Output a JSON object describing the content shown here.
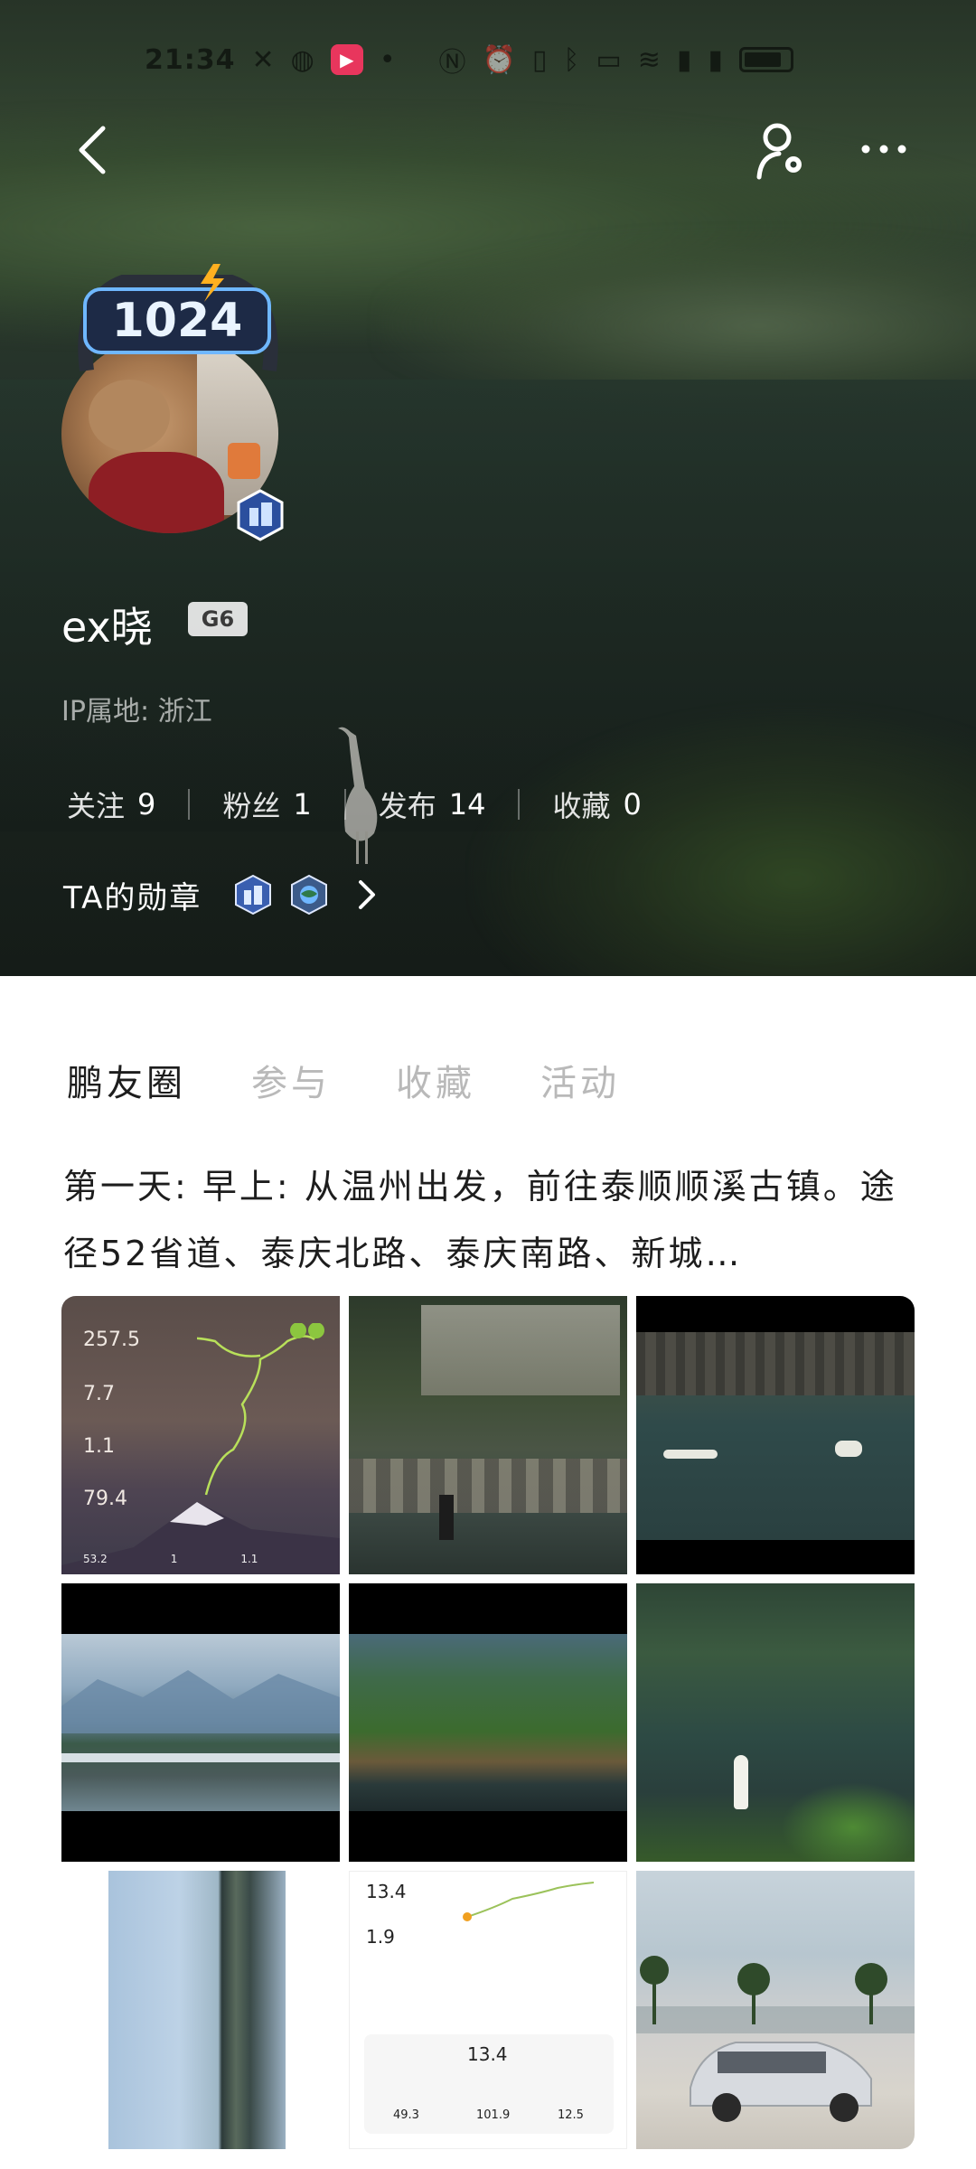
{
  "status_bar": {
    "time": "21:34"
  },
  "profile": {
    "avatar_frame_text": "1024",
    "username": "ex晓",
    "grade": "G6",
    "ip_location": "IP属地: 浙江",
    "stats": [
      {
        "label": "关注",
        "value": "9"
      },
      {
        "label": "粉丝",
        "value": "1"
      },
      {
        "label": "发布",
        "value": "14"
      },
      {
        "label": "收藏",
        "value": "0"
      }
    ],
    "medals_label": "TA的勋章"
  },
  "tabs": [
    {
      "label": "鹏友圈",
      "active": true
    },
    {
      "label": "参与",
      "active": false
    },
    {
      "label": "收藏",
      "active": false
    },
    {
      "label": "活动",
      "active": false
    }
  ],
  "post": {
    "text": "第一天: 早上: 从温州出发，前往泰顺顺溪古镇。途径52省道、泰庆北路、泰庆南路、新城…",
    "map_card": {
      "values": [
        "257.5",
        "7.7",
        "1.1",
        "79.4"
      ],
      "footer": [
        "53.2",
        "1",
        "1.1"
      ]
    },
    "stats_card": {
      "values": [
        "13.4",
        "1.9",
        "13.4"
      ],
      "bottom": [
        "49.3",
        "101.9",
        "12.5"
      ]
    }
  },
  "colors": {
    "cover_dark": "#1f2b24",
    "tab_inactive": "#b9b9b9",
    "text_primary": "#1d1d1d"
  }
}
